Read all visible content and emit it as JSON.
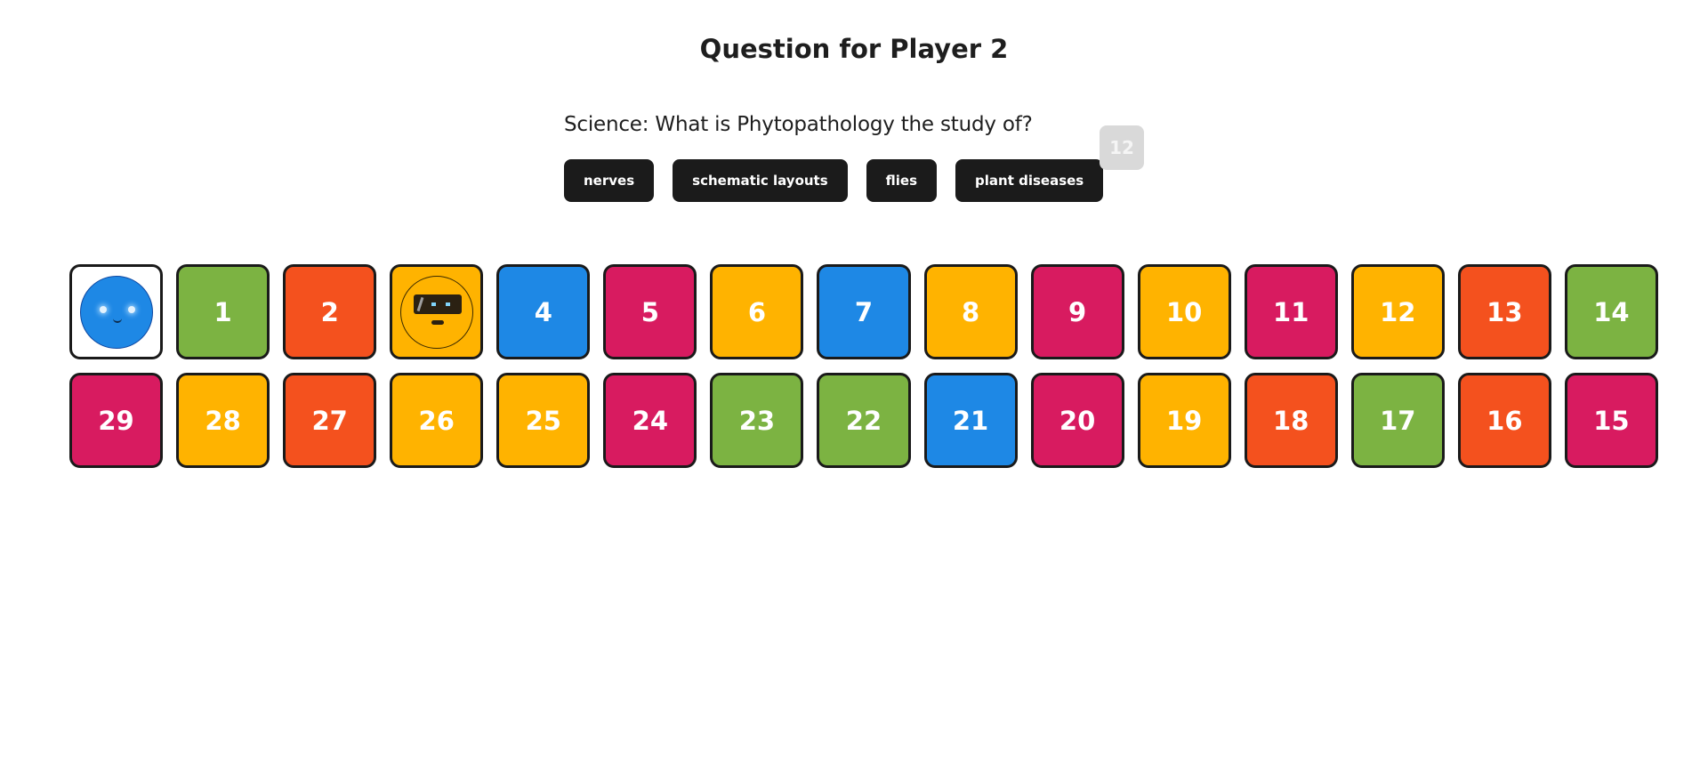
{
  "header": {
    "title": "Question for Player 2"
  },
  "question": {
    "text": "Science: What is Phytopathology the study of?",
    "answers": [
      "nerves",
      "schematic layouts",
      "flies",
      "plant diseases"
    ],
    "timer": "12"
  },
  "board": {
    "colors": {
      "green": "#7cb342",
      "orange": "#f4511e",
      "amber": "#ffb300",
      "blue": "#1e88e5",
      "pink": "#d81b60"
    },
    "row1": [
      {
        "label": "",
        "color": "white",
        "token": "blue-smiley-player-token"
      },
      {
        "label": "1",
        "color": "green"
      },
      {
        "label": "2",
        "color": "orange"
      },
      {
        "label": "",
        "color": "amber",
        "token": "robot-player-token"
      },
      {
        "label": "4",
        "color": "blue"
      },
      {
        "label": "5",
        "color": "pink"
      },
      {
        "label": "6",
        "color": "amber"
      },
      {
        "label": "7",
        "color": "blue"
      },
      {
        "label": "8",
        "color": "amber"
      },
      {
        "label": "9",
        "color": "pink"
      },
      {
        "label": "10",
        "color": "amber"
      },
      {
        "label": "11",
        "color": "pink"
      },
      {
        "label": "12",
        "color": "amber"
      },
      {
        "label": "13",
        "color": "orange"
      },
      {
        "label": "14",
        "color": "green"
      }
    ],
    "row2": [
      {
        "label": "29",
        "color": "pink"
      },
      {
        "label": "28",
        "color": "amber"
      },
      {
        "label": "27",
        "color": "orange"
      },
      {
        "label": "26",
        "color": "amber"
      },
      {
        "label": "25",
        "color": "amber"
      },
      {
        "label": "24",
        "color": "pink"
      },
      {
        "label": "23",
        "color": "green"
      },
      {
        "label": "22",
        "color": "green"
      },
      {
        "label": "21",
        "color": "blue"
      },
      {
        "label": "20",
        "color": "pink"
      },
      {
        "label": "19",
        "color": "amber"
      },
      {
        "label": "18",
        "color": "orange"
      },
      {
        "label": "17",
        "color": "green"
      },
      {
        "label": "16",
        "color": "orange"
      },
      {
        "label": "15",
        "color": "pink"
      }
    ]
  }
}
